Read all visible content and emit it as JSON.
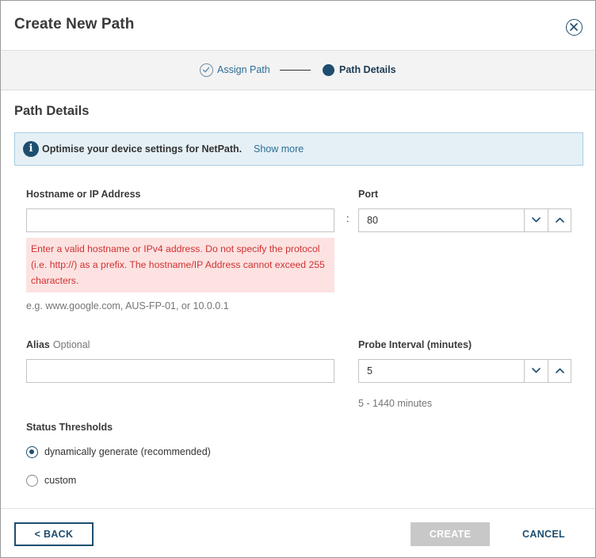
{
  "dialog": {
    "title": "Create New Path",
    "close_icon": "close-circle-icon"
  },
  "stepper": {
    "steps": [
      {
        "label": "Assign Path",
        "state": "completed",
        "icon": "check-circle-icon"
      },
      {
        "label": "Path Details",
        "state": "current",
        "icon": "filled-circle-icon"
      }
    ]
  },
  "section": {
    "title": "Path Details"
  },
  "info": {
    "icon": "info-icon",
    "text": "Optimise your device settings for NetPath.",
    "link": "Show more"
  },
  "hostname": {
    "label": "Hostname or IP Address",
    "value": "",
    "error": "Enter a valid hostname or IPv4 address. Do not specify the protocol (i.e. http://) as a prefix. The hostname/IP Address cannot exceed 255 characters.",
    "hint": "e.g. www.google.com, AUS-FP-01, or 10.0.0.1"
  },
  "port": {
    "separator": ":",
    "label": "Port",
    "value": "80"
  },
  "alias": {
    "label": "Alias",
    "optional": "Optional",
    "value": ""
  },
  "probe_interval": {
    "label": "Probe Interval (minutes)",
    "value": "5",
    "hint": "5 - 1440 minutes"
  },
  "thresholds": {
    "label": "Status Thresholds",
    "options": [
      {
        "label": "dynamically generate (recommended)",
        "checked": true
      },
      {
        "label": "custom",
        "checked": false
      }
    ]
  },
  "footer": {
    "back_label": "< BACK",
    "create_label": "CREATE",
    "cancel_label": "CANCEL"
  },
  "colors": {
    "primary": "#1e4e6f",
    "link": "#2b6d96",
    "error_text": "#d0322f",
    "error_bg": "#fde2e2",
    "info_bg": "#e5f0f6",
    "disabled_button": "#c8c8c8"
  }
}
